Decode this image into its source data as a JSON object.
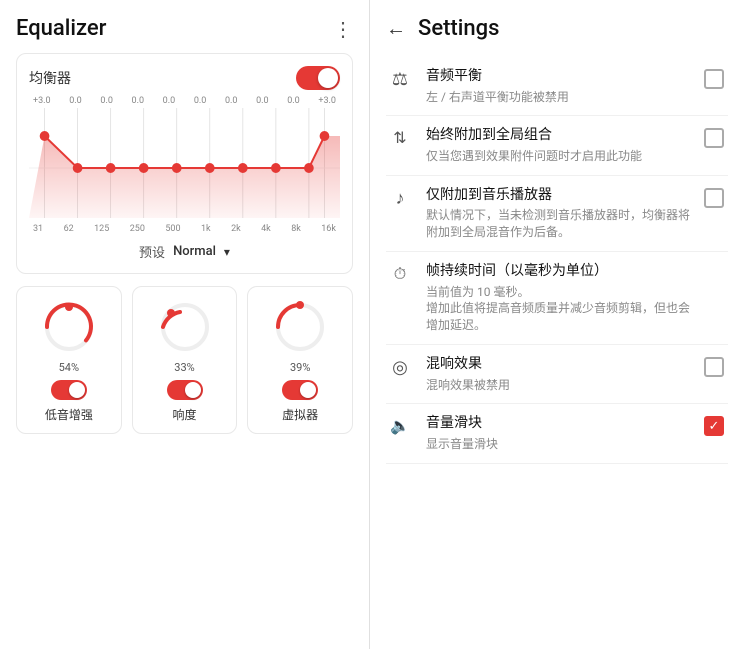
{
  "left": {
    "title": "Equalizer",
    "menu_icon": "⋮",
    "eq_section": {
      "label": "均衡器",
      "toggle_on": true,
      "db_labels": [
        "+3.0",
        "0.0",
        "0.0",
        "0.0",
        "0.0",
        "0.0",
        "0.0",
        "0.0",
        "0.0",
        "+3.0"
      ],
      "freq_labels": [
        "31",
        "62",
        "125",
        "250",
        "500",
        "1k",
        "2k",
        "4k",
        "8k",
        "16k"
      ],
      "preset_label": "预设",
      "preset_value": "Normal",
      "dropdown_icon": "▾",
      "eq_points": [
        {
          "freq": 0,
          "db": 3.0
        },
        {
          "freq": 1,
          "db": 0.0
        },
        {
          "freq": 2,
          "db": 0.0
        },
        {
          "freq": 3,
          "db": 0.0
        },
        {
          "freq": 4,
          "db": 0.0
        },
        {
          "freq": 5,
          "db": 0.0
        },
        {
          "freq": 6,
          "db": 0.0
        },
        {
          "freq": 7,
          "db": 0.0
        },
        {
          "freq": 8,
          "db": 0.0
        },
        {
          "freq": 9,
          "db": 3.0
        }
      ]
    },
    "controls": [
      {
        "id": "bass-boost",
        "percent": "54%",
        "name": "低音增强",
        "angle": 140,
        "toggle_on": true
      },
      {
        "id": "loudness",
        "percent": "33%",
        "name": "响度",
        "angle": 80,
        "toggle_on": true
      },
      {
        "id": "virtualizer",
        "percent": "39%",
        "name": "虚拟器",
        "angle": 100,
        "toggle_on": true
      }
    ]
  },
  "right": {
    "back_icon": "←",
    "title": "Settings",
    "items": [
      {
        "id": "audio-balance",
        "icon": "⚖",
        "main_label": "音频平衡",
        "sub_label": "左 / 右声道平衡功能被禁用",
        "control_type": "checkbox",
        "checked": false
      },
      {
        "id": "attach-global",
        "icon": "↑↓",
        "main_label": "始终附加到全局组合",
        "sub_label": "仅当您遇到效果附件问题时才启用此功能",
        "control_type": "checkbox",
        "checked": false
      },
      {
        "id": "attach-music",
        "icon": "♪",
        "main_label": "仅附加到音乐播放器",
        "sub_label": "默认情况下，当未检测到音乐播放器时，均衡器将附加到全局混音作为后备。",
        "control_type": "checkbox",
        "checked": false
      },
      {
        "id": "frame-duration",
        "icon": "🕐",
        "main_label": "帧持续时间（以毫秒为单位）",
        "sub_label": "当前值为 10 毫秒。\n增加此值将提高音频质量并减少音频剪辑，但也会增加延迟。",
        "control_type": "none",
        "checked": false
      },
      {
        "id": "reverb-effect",
        "icon": "◎",
        "main_label": "混响效果",
        "sub_label": "混响效果被禁用",
        "control_type": "checkbox",
        "checked": false
      },
      {
        "id": "volume-slider",
        "icon": "♦",
        "main_label": "音量滑块",
        "sub_label": "显示音量滑块",
        "control_type": "checkbox",
        "checked": true
      }
    ]
  }
}
